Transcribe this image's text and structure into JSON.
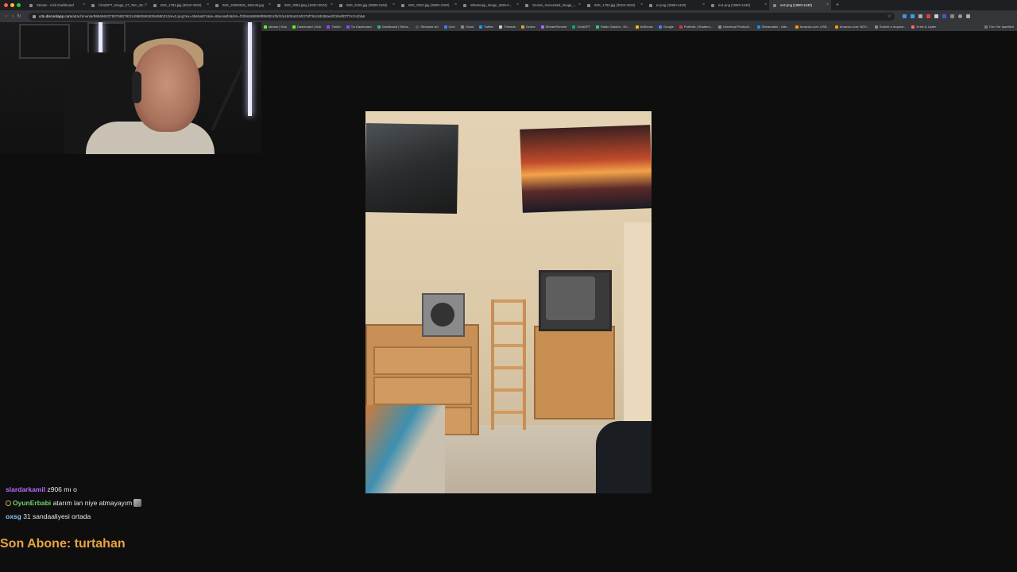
{
  "browser": {
    "tabs": [
      {
        "label": "Stream - Kick Dashboard",
        "active": false
      },
      {
        "label": "ChatGPT_Image_27_Tem_20...",
        "active": false
      },
      {
        "label": "IMG_1782.jpg (3024×4032)",
        "active": false
      },
      {
        "label": "IMG_20260525_182149.jpg",
        "active": false
      },
      {
        "label": "IMG_3053.jpeg (4032×3024)",
        "active": false
      },
      {
        "label": "IMG_8105.jpg (2880×2160)",
        "active": false
      },
      {
        "label": "IMG_0010.jpg (2880×2160)",
        "active": false
      },
      {
        "label": "WhatsApp_Image_2026-0...",
        "active": false
      },
      {
        "label": "Gemini_Generated_Image_...",
        "active": false
      },
      {
        "label": "IMG_1763.jpg (3024×4032)",
        "active": false
      },
      {
        "label": "ev.png (1080×1440)",
        "active": false
      },
      {
        "label": "ev1.png (1080×1440)",
        "active": false
      },
      {
        "label": "ev2.png (1080×1440)",
        "active": true
      }
    ],
    "url_host": "cdn.discordapp.com",
    "url_path": "/attachments/995696327507680783/1498609638364990210/ev2.png?ex=69e5a874&is=69e4a6f4&hm=f30b6469959f8960b1f0d1fa1902a0190376f764c6b386ed0f1fe6f07f7a7e1bb&",
    "bookmarks": [
      {
        "label": "stream | Kick",
        "color": "#53fc18"
      },
      {
        "label": "Dashboard | Kick",
        "color": "#53fc18"
      },
      {
        "label": "Twitch",
        "color": "#9146ff"
      },
      {
        "label": "Tw Dashboard",
        "color": "#9146ff"
      },
      {
        "label": "Dashboard | Strea...",
        "color": "#2bb673"
      },
      {
        "label": "Streamer Ad",
        "color": "#555"
      },
      {
        "label": "Qovi",
        "color": "#3b82f6"
      },
      {
        "label": "Cloud",
        "color": "#888"
      },
      {
        "label": "Twitter",
        "color": "#1d9bf0"
      },
      {
        "label": "Threads",
        "color": "#ccc"
      },
      {
        "label": "Ozuba",
        "color": "#e0a030"
      },
      {
        "label": "StreamRemote",
        "color": "#aa66ff"
      },
      {
        "label": "ChatGPT",
        "color": "#10a37f"
      },
      {
        "label": "Radio Garden - Kh...",
        "color": "#2ecc71"
      },
      {
        "label": "AdSense",
        "color": "#fbbc04"
      },
      {
        "label": "Google",
        "color": "#4285f4"
      },
      {
        "label": "Portfolio | Shutters...",
        "color": "#d33"
      },
      {
        "label": "Universal Producti...",
        "color": "#888"
      },
      {
        "label": "Streamable - vide...",
        "color": "#0f90fa"
      },
      {
        "label": "Amazon.com: USB...",
        "color": "#ff9900"
      },
      {
        "label": "Amazon.com: NOV...",
        "color": "#ff9900"
      },
      {
        "label": "Submit a request...",
        "color": "#888"
      },
      {
        "label": "Drive & Listen",
        "color": "#ff6b6b"
      }
    ],
    "all_bookmarks_label": "Tüm Yer İşaretleri"
  },
  "chat": {
    "messages": [
      {
        "user": "slardarkamil",
        "user_color": "#b46cff",
        "text": "z906 mı o",
        "badge": false,
        "emote": false
      },
      {
        "user": "OyunErbabi",
        "user_color": "#6fd36b",
        "text": "atarım lan niye atmayayım",
        "badge": true,
        "emote": true
      },
      {
        "user": "oxsg",
        "user_color": "#7fc8ff",
        "text": "31 sandaaliyesi ortada",
        "badge": false,
        "emote": false
      }
    ]
  },
  "overlay": {
    "last_sub": "Son Abone: turtahan",
    "last_sub_color": "#e8a440"
  }
}
